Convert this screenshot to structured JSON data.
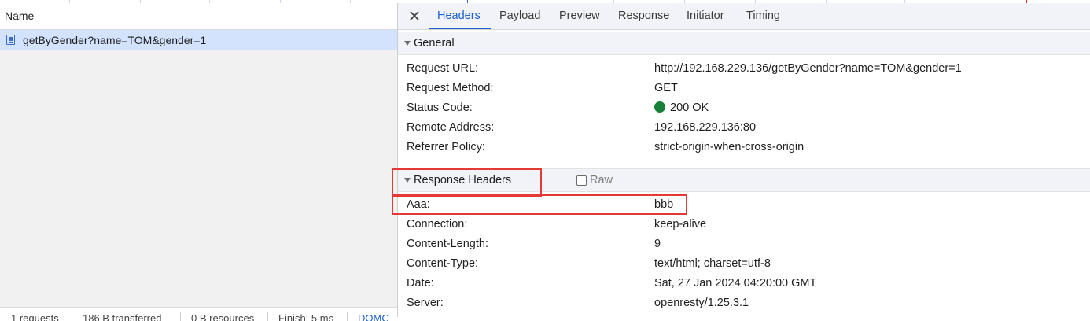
{
  "list": {
    "column_header": "Name",
    "requests": [
      {
        "name": "getByGender?name=TOM&gender=1",
        "selected": true
      }
    ],
    "status_bar": [
      "1 requests",
      "186 B transferred",
      "0 B resources",
      "Finish: 5 ms",
      "DOMC"
    ]
  },
  "details": {
    "tabs": [
      "Headers",
      "Payload",
      "Preview",
      "Response",
      "Initiator",
      "Timing"
    ],
    "active_tab": "Headers",
    "general": {
      "title": "General",
      "rows": [
        {
          "key": "Request URL:",
          "value": "http://192.168.229.136/getByGender?name=TOM&gender=1"
        },
        {
          "key": "Request Method:",
          "value": "GET"
        },
        {
          "key": "Status Code:",
          "value": "200 OK"
        },
        {
          "key": "Remote Address:",
          "value": "192.168.229.136:80"
        },
        {
          "key": "Referrer Policy:",
          "value": "strict-origin-when-cross-origin"
        }
      ]
    },
    "response_headers": {
      "title": "Response Headers",
      "raw_label": "Raw",
      "raw_checked": false,
      "rows": [
        {
          "key": "Aaa:",
          "value": "bbb"
        },
        {
          "key": "Connection:",
          "value": "keep-alive"
        },
        {
          "key": "Content-Length:",
          "value": "9"
        },
        {
          "key": "Content-Type:",
          "value": "text/html; charset=utf-8"
        },
        {
          "key": "Date:",
          "value": "Sat, 27 Jan 2024 04:20:00 GMT"
        },
        {
          "key": "Server:",
          "value": "openresty/1.25.3.1"
        }
      ]
    }
  },
  "colors": {
    "selected_row": "#d3e3fd",
    "active_tab": "#1a5fd0",
    "status_ok": "#188038",
    "annotation": "#e53935"
  },
  "icons": [
    "document-icon",
    "close-icon",
    "triangle-down-icon",
    "status-dot-icon",
    "checkbox-icon"
  ]
}
